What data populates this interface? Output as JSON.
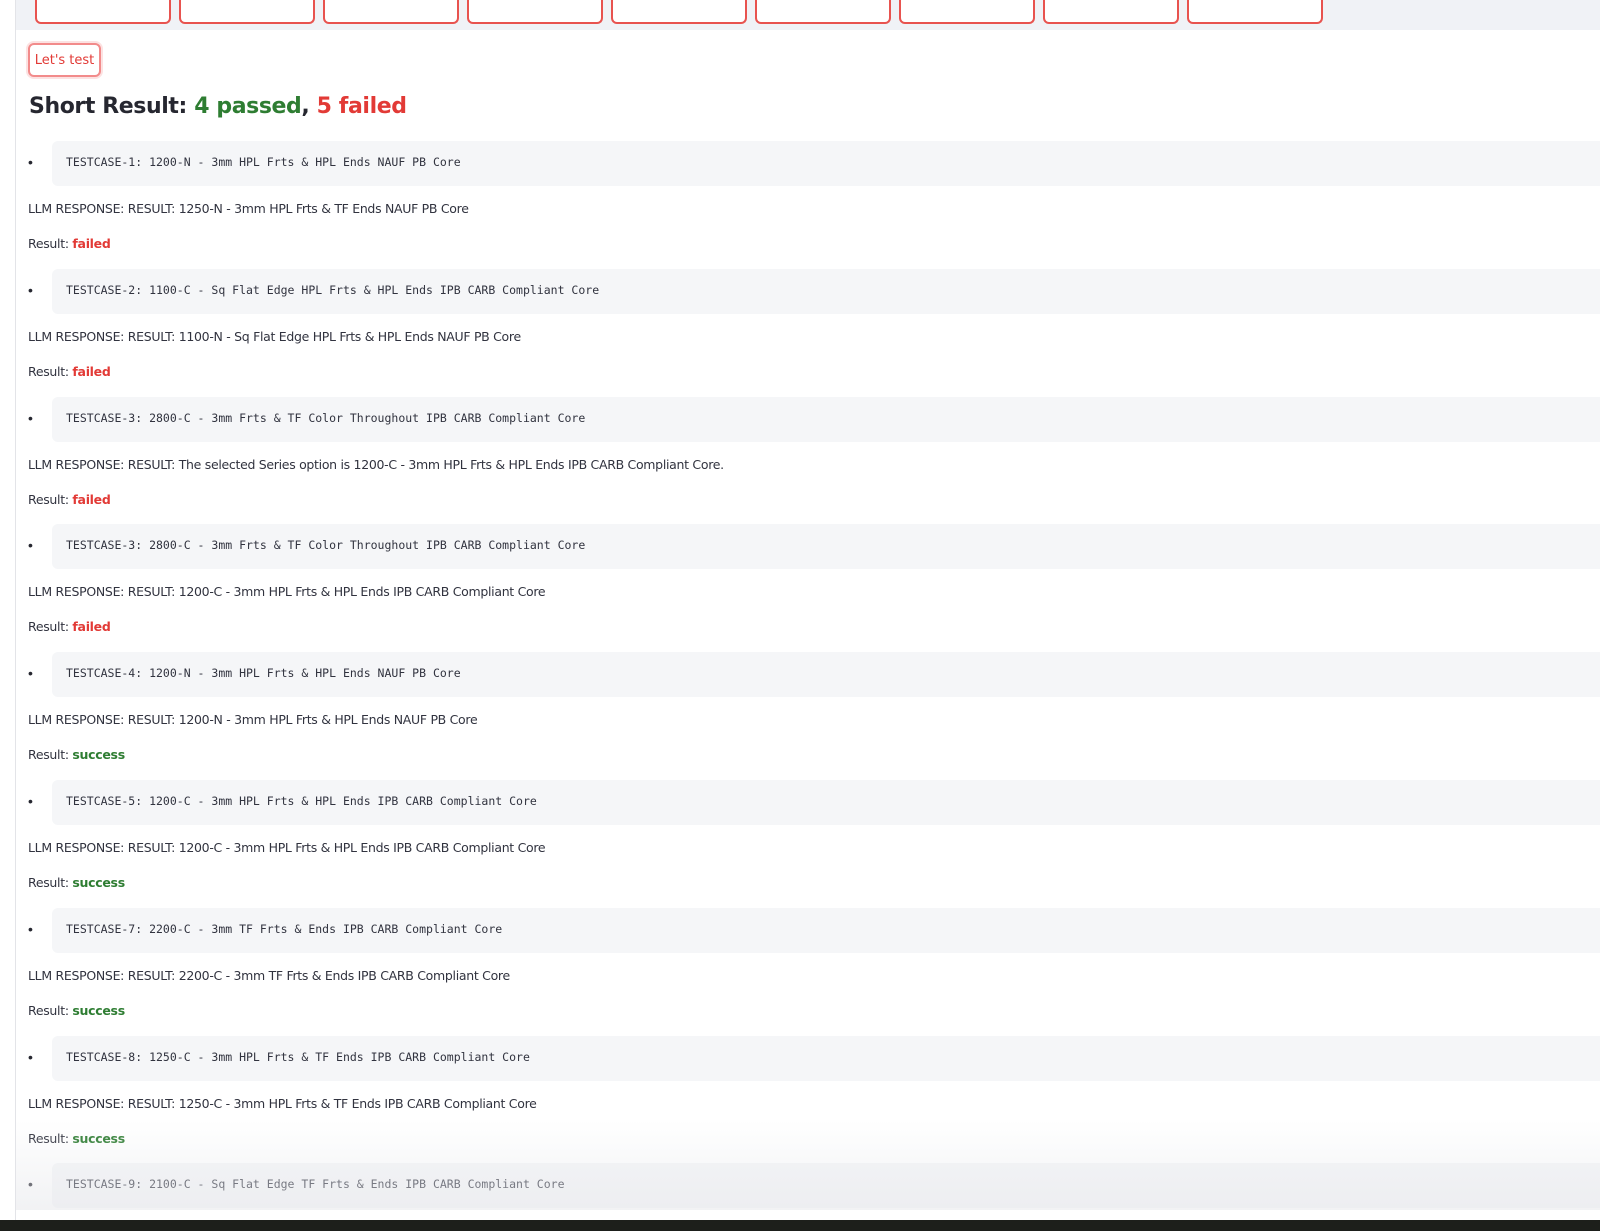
{
  "button": {
    "label": "Let's test"
  },
  "summary": {
    "prefix": "Short Result: ",
    "passed": "4 passed",
    "separator": ", ",
    "failed": "5 failed"
  },
  "result_label": "Result: ",
  "colors": {
    "accent_red": "#e23a36",
    "success_green": "#2e7d32",
    "code_bg": "#f5f6f8"
  },
  "testcases": [
    {
      "input": "TESTCASE-1: 1200-N - 3mm HPL Frts & HPL Ends NAUF PB Core",
      "response": "LLM RESPONSE: RESULT: 1250-N - 3mm HPL Frts & TF Ends NAUF PB Core",
      "status": "failed"
    },
    {
      "input": "TESTCASE-2: 1100-C - Sq Flat Edge HPL Frts & HPL Ends IPB CARB Compliant Core",
      "response": "LLM RESPONSE: RESULT: 1100-N - Sq Flat Edge HPL Frts & HPL Ends NAUF PB Core",
      "status": "failed"
    },
    {
      "input": "TESTCASE-3: 2800-C - 3mm Frts & TF Color Throughout IPB CARB Compliant Core",
      "response": "LLM RESPONSE: RESULT: The selected Series option is 1200-C - 3mm HPL Frts & HPL Ends IPB CARB Compliant Core.",
      "status": "failed"
    },
    {
      "input": "TESTCASE-3: 2800-C - 3mm Frts & TF Color Throughout IPB CARB Compliant Core",
      "response": "LLM RESPONSE: RESULT: 1200-C - 3mm HPL Frts & HPL Ends IPB CARB Compliant Core",
      "status": "failed"
    },
    {
      "input": "TESTCASE-4: 1200-N - 3mm HPL Frts & HPL Ends NAUF PB Core",
      "response": "LLM RESPONSE: RESULT: 1200-N - 3mm HPL Frts & HPL Ends NAUF PB Core",
      "status": "success"
    },
    {
      "input": "TESTCASE-5: 1200-C - 3mm HPL Frts & HPL Ends IPB CARB Compliant Core",
      "response": "LLM RESPONSE: RESULT: 1200-C - 3mm HPL Frts & HPL Ends IPB CARB Compliant Core",
      "status": "success"
    },
    {
      "input": "TESTCASE-7: 2200-C - 3mm TF Frts & Ends IPB CARB Compliant Core",
      "response": "LLM RESPONSE: RESULT: 2200-C - 3mm TF Frts & Ends IPB CARB Compliant Core",
      "status": "success"
    },
    {
      "input": "TESTCASE-8: 1250-C - 3mm HPL Frts & TF Ends IPB CARB Compliant Core",
      "response": "LLM RESPONSE: RESULT: 1250-C - 3mm HPL Frts & TF Ends IPB CARB Compliant Core",
      "status": "success"
    },
    {
      "input": "TESTCASE-9: 2100-C - Sq Flat Edge TF Frts & Ends IPB CARB Compliant Core",
      "response": "",
      "status": ""
    }
  ]
}
